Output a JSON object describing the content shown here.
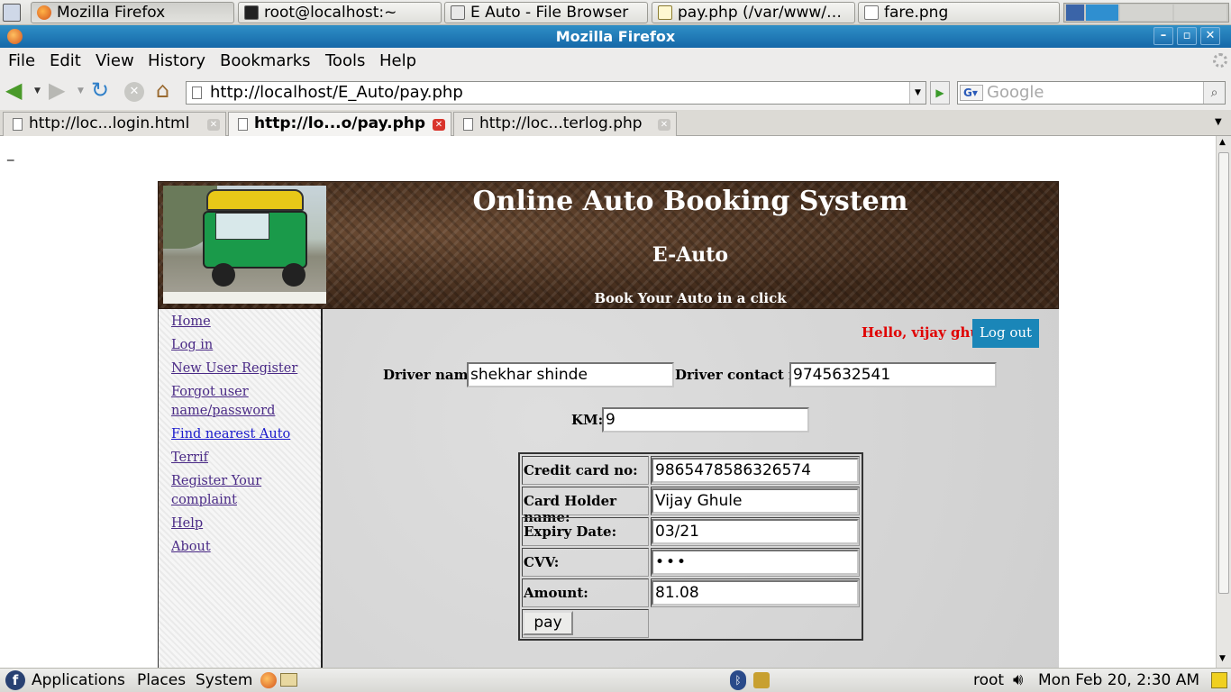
{
  "top_panel": {
    "tasks": [
      {
        "label": "Mozilla Firefox",
        "icon": "firefox-icon"
      },
      {
        "label": "root@localhost:~",
        "icon": "terminal-icon"
      },
      {
        "label": "E  Auto - File Browser",
        "icon": "folder-icon"
      },
      {
        "label": "pay.php (/var/www/…",
        "icon": "text-editor-icon"
      },
      {
        "label": "fare.png",
        "icon": "image-file-icon"
      }
    ]
  },
  "window": {
    "title": "Mozilla Firefox"
  },
  "menubar": {
    "items": [
      "File",
      "Edit",
      "View",
      "History",
      "Bookmarks",
      "Tools",
      "Help"
    ]
  },
  "navbar": {
    "url": "http://localhost/E_Auto/pay.php",
    "search_placeholder": "Google"
  },
  "tabs": [
    {
      "label": "http://loc...login.html",
      "selected": false
    },
    {
      "label": "http://lo...o/pay.php",
      "selected": true
    },
    {
      "label": "http://loc...terlog.php",
      "selected": false
    }
  ],
  "page": {
    "stray_text": "_",
    "banner": {
      "title": "Online Auto Booking System",
      "subtitle": "E-Auto",
      "tagline": "Book Your Auto in a click"
    },
    "sidebar": [
      "Home",
      "Log in",
      "New User Register",
      "Forgot user name/password",
      "Find nearest Auto",
      "Terrif",
      "Register Your complaint",
      "Help",
      "About"
    ],
    "greeting": "Hello, vijay ghule",
    "logout": "Log out",
    "driver_name_label": "Driver name:",
    "driver_name": "shekhar shinde",
    "driver_contact_label": "Driver contact no:",
    "driver_contact": "9745632541",
    "km_label": "KM:",
    "km": "9",
    "payment": {
      "rows": [
        {
          "label": "Credit card no:",
          "value": "9865478586326574"
        },
        {
          "label": "Card Holder name:",
          "value": "Vijay Ghule"
        },
        {
          "label": "Expiry Date:",
          "value": "03/21"
        },
        {
          "label": "CVV:",
          "value": "•••"
        },
        {
          "label": "Amount:",
          "value": "81.08"
        }
      ],
      "pay_button": "pay"
    }
  },
  "bottom_panel": {
    "applications": "Applications",
    "places": "Places",
    "system": "System",
    "user": "root",
    "clock": "Mon Feb 20,  2:30 AM"
  },
  "colors": {
    "titlebar": "#1668a8",
    "greeting": "#e00000",
    "logout_bg": "#1a86b8"
  }
}
